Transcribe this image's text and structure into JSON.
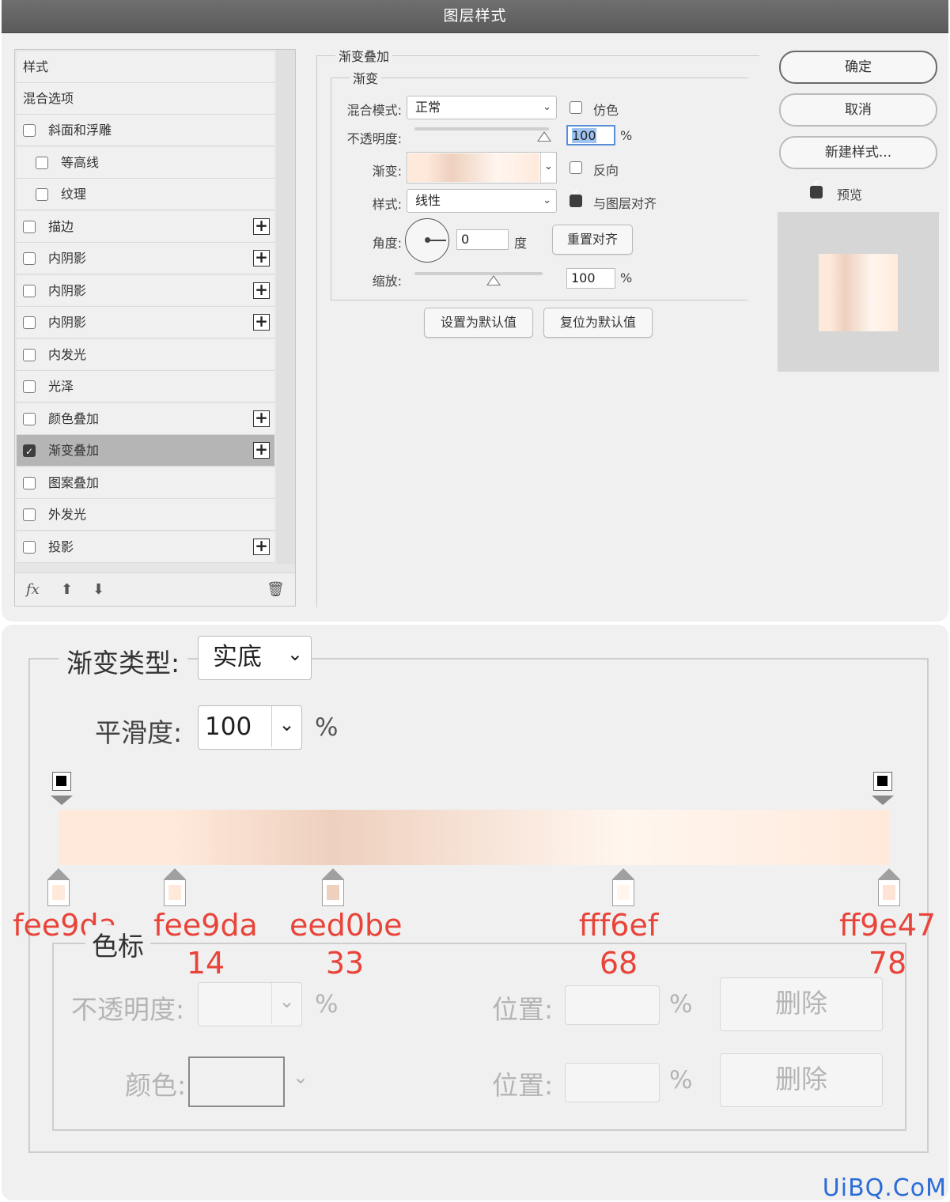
{
  "dialog": {
    "title": "图层样式",
    "style_list": {
      "header": "样式",
      "blend_options": "混合选项",
      "items": [
        {
          "label": "斜面和浮雕",
          "checked": false,
          "plus": false
        },
        {
          "label": "等高线",
          "checked": false,
          "plus": false
        },
        {
          "label": "纹理",
          "checked": false,
          "plus": false
        },
        {
          "label": "描边",
          "checked": false,
          "plus": true
        },
        {
          "label": "内阴影",
          "checked": false,
          "plus": true
        },
        {
          "label": "内阴影",
          "checked": false,
          "plus": true
        },
        {
          "label": "内阴影",
          "checked": false,
          "plus": true
        },
        {
          "label": "内发光",
          "checked": false,
          "plus": false
        },
        {
          "label": "光泽",
          "checked": false,
          "plus": false
        },
        {
          "label": "颜色叠加",
          "checked": false,
          "plus": true
        },
        {
          "label": "渐变叠加",
          "checked": true,
          "plus": true
        },
        {
          "label": "图案叠加",
          "checked": false,
          "plus": false
        },
        {
          "label": "外发光",
          "checked": false,
          "plus": false
        },
        {
          "label": "投影",
          "checked": false,
          "plus": true
        }
      ],
      "footer_fx": "fx"
    },
    "gradient_overlay": {
      "group_title": "渐变叠加",
      "sub_title": "渐变",
      "blend_mode_label": "混合模式:",
      "blend_mode_value": "正常",
      "dither_label": "仿色",
      "opacity_label": "不透明度:",
      "opacity_value": "100",
      "opacity_unit": "%",
      "gradient_label": "渐变:",
      "reverse_label": "反向",
      "style_label": "样式:",
      "style_value": "线性",
      "align_label": "与图层对齐",
      "angle_label": "角度:",
      "angle_value": "0",
      "angle_unit": "度",
      "reset_align_button": "重置对齐",
      "scale_label": "缩放:",
      "scale_value": "100",
      "scale_unit": "%",
      "set_default_button": "设置为默认值",
      "reset_default_button": "复位为默认值"
    },
    "buttons": {
      "ok": "确定",
      "cancel": "取消",
      "new_style": "新建样式...",
      "preview": "预览"
    }
  },
  "editor": {
    "gradient_type_label": "渐变类型:",
    "gradient_type_value": "实底",
    "smoothness_label": "平滑度:",
    "smoothness_value": "100",
    "smoothness_unit": "%",
    "stops_group": "色标",
    "opacity_label": "不透明度:",
    "opacity_unit": "%",
    "position_label": "位置:",
    "position_unit": "%",
    "delete_button": "删除",
    "color_label": "颜色:",
    "color_stops": [
      {
        "color": "#fee9da",
        "hex": "fee9da",
        "pos": "",
        "location": 0
      },
      {
        "color": "#fee9da",
        "hex": "fee9da",
        "pos": "14",
        "location": 14
      },
      {
        "color": "#eed0be",
        "hex": "eed0be",
        "pos": "33",
        "location": 33
      },
      {
        "color": "#fff6ef",
        "hex": "fff6ef",
        "pos": "68",
        "location": 68
      },
      {
        "color": "#ff9e47",
        "hex": "ff9e47",
        "pos": "78",
        "location": 100
      }
    ]
  },
  "watermark": "UiBQ.CoM"
}
